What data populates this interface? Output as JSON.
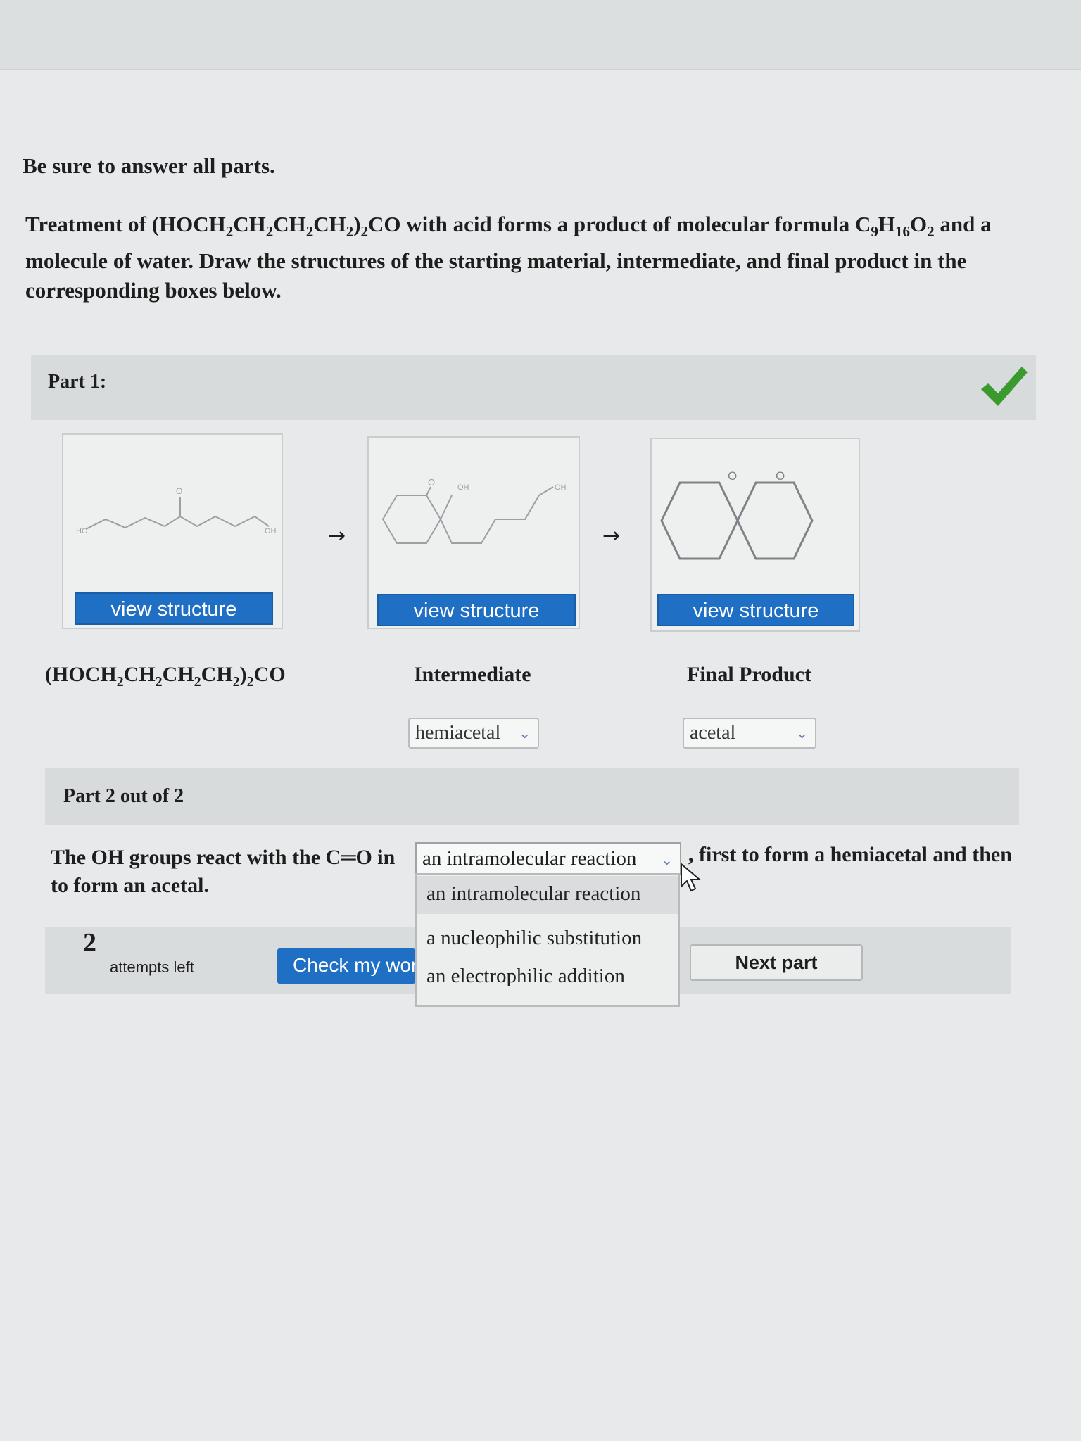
{
  "intro": "Be sure to answer all parts.",
  "question": {
    "lead": "Treatment of ",
    "formula_prefix": "(HOCH",
    "sub1": "2",
    "p2": "CH",
    "sub2": "2",
    "p3": "CH",
    "sub3": "2",
    "p4": "CH",
    "sub4": "2",
    "p5": ")",
    "sub5": "2",
    "p6": "CO with acid forms a product of molecular formula C",
    "sub6": "9",
    "p7": "H",
    "sub7": "16",
    "p8": "O",
    "sub8": "2",
    "p9": " and a molecule of water. Draw the structures of the starting material, intermediate, and final product in the corresponding boxes below."
  },
  "part1": {
    "label": "Part 1:",
    "status_icon": "checkmark-icon",
    "status_color": "#3a9a2e",
    "boxes": [
      {
        "button": "view structure",
        "caption": "(HOCH2CH2CH2CH2)2CO",
        "atom_labels": [
          "HO",
          "O",
          "OH"
        ]
      },
      {
        "button": "view structure",
        "caption": "Intermediate",
        "atom_labels": [
          "O",
          "OH",
          "OH"
        ]
      },
      {
        "button": "view structure",
        "caption": "Final Product",
        "atom_labels": [
          "O",
          "O"
        ]
      }
    ],
    "arrow": "→",
    "intermediate_select": "hemiacetal",
    "final_select": "acetal"
  },
  "part2": {
    "label": "Part 2 out of 2",
    "sentence_before": "The OH groups react with the C═O in",
    "sentence_after": ", first to form a hemiacetal and then",
    "sentence_line2": "to form an acetal.",
    "selected": "an intramolecular reaction",
    "options": [
      "an intramolecular reaction",
      "a nucleophilic substitution",
      "an electrophilic addition"
    ]
  },
  "footer": {
    "attempts_num": "2",
    "attempts_text": "attempts left",
    "check_label": "Check my work",
    "next_label": "Next part"
  }
}
